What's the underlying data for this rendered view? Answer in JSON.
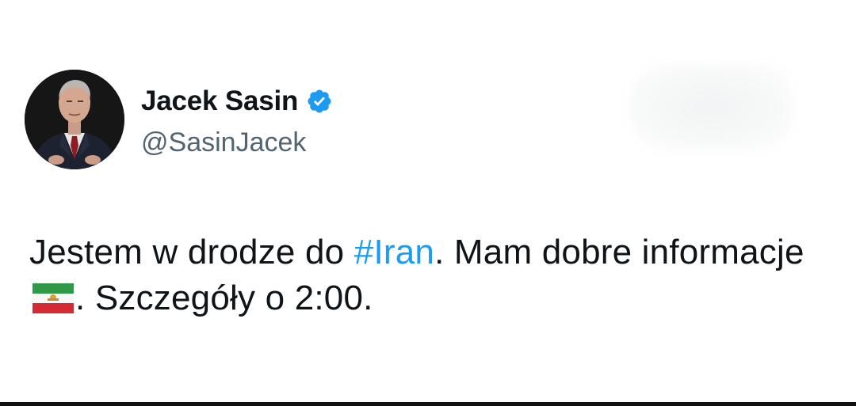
{
  "tweet": {
    "author": {
      "display_name": "Jacek Sasin",
      "handle": "@SasinJacek",
      "verified": true,
      "verified_icon": "verified-badge-icon"
    },
    "text": {
      "part1": "Jestem w drodze do ",
      "hashtag": "#Iran",
      "part2": ". Mam dobre informacje ",
      "flag": "iran-pre-revolution-flag-icon",
      "part3": ". Szczegóły o 2:00."
    }
  },
  "colors": {
    "text": "#0f1419",
    "secondary": "#536471",
    "accent": "#1d9bf0",
    "background": "#ffffff"
  }
}
